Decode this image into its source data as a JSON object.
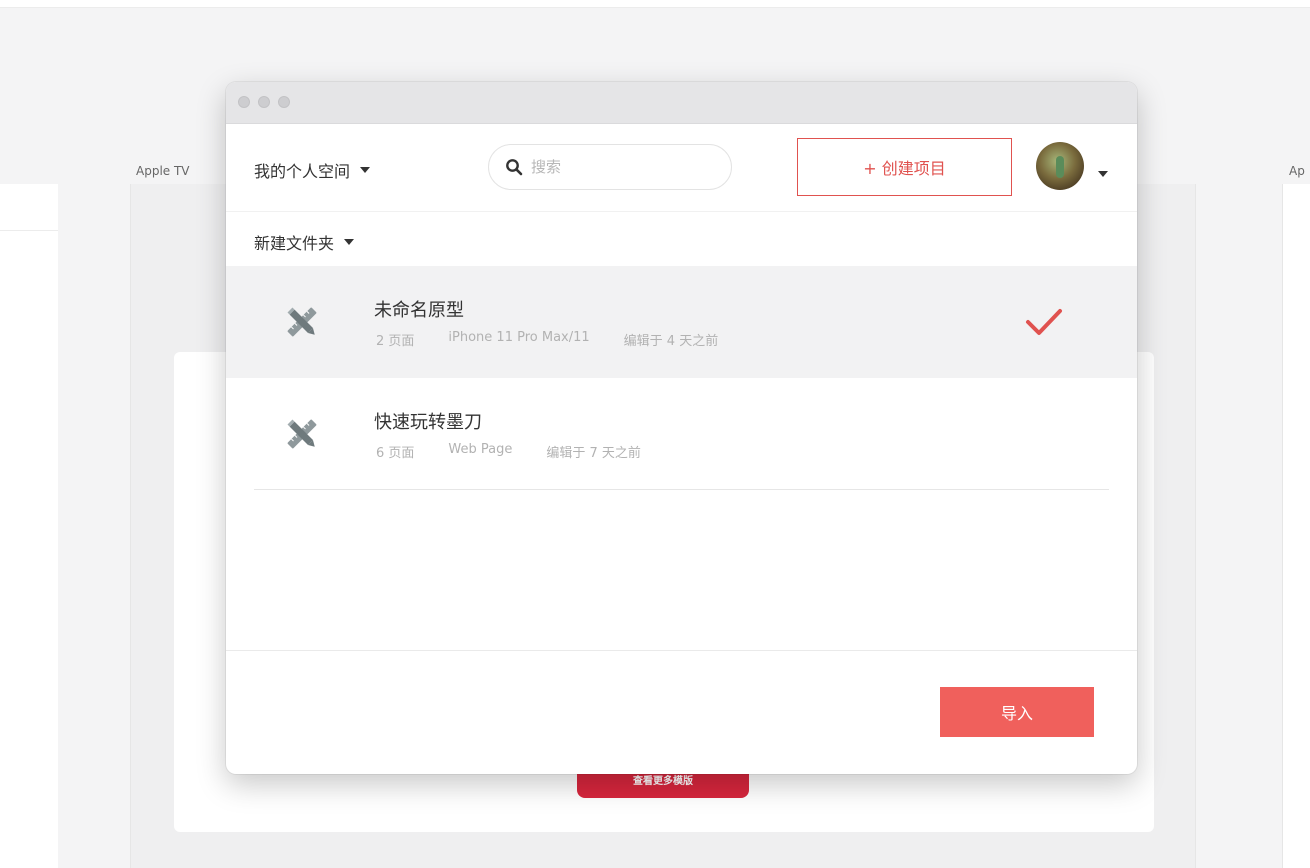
{
  "background": {
    "left_label": "Apple TV",
    "right_label": "Ap",
    "red_button_label": "查看更多模版"
  },
  "window": {
    "header": {
      "workspace_label": "我的个人空间",
      "search_placeholder": "搜索",
      "create_button_label": "+ 创建项目"
    },
    "folder_label": "新建文件夹",
    "projects": [
      {
        "name": "未命名原型",
        "pages": "2 页面",
        "device": "iPhone 11 Pro Max/11",
        "edited": "编辑于 4 天之前",
        "selected": true
      },
      {
        "name": "快速玩转墨刀",
        "pages": "6 页面",
        "device": "Web Page",
        "edited": "编辑于 7 天之前",
        "selected": false
      }
    ],
    "import_button_label": "导入"
  },
  "colors": {
    "accent": "#e0524f",
    "import_button": "#f0605c",
    "selected_row": "#f2f2f3",
    "background_red_button": "#d7263d"
  },
  "icons": {
    "search": "search-icon",
    "project": "pencil-ruler-icon",
    "check": "checkmark-icon",
    "dropdown": "caret-down-icon"
  }
}
